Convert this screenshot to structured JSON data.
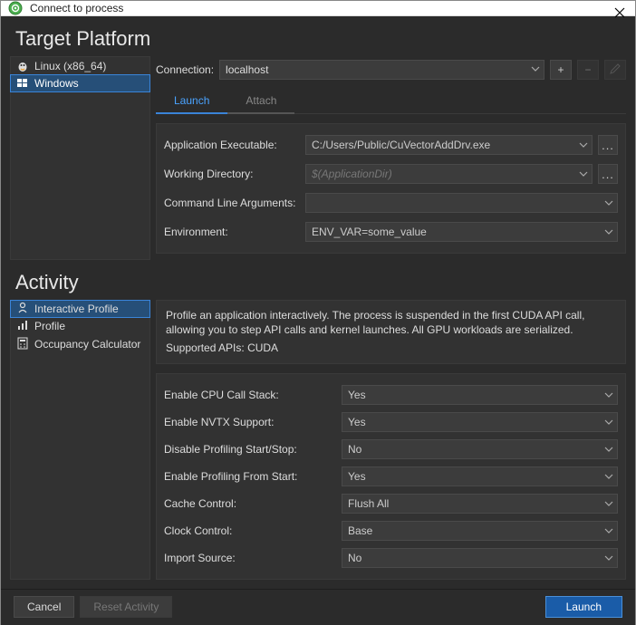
{
  "window": {
    "title": "Connect to process"
  },
  "sections": {
    "target_platform": "Target Platform",
    "activity": "Activity"
  },
  "platforms": [
    {
      "label": "Linux (x86_64)",
      "selected": false
    },
    {
      "label": "Windows",
      "selected": true
    }
  ],
  "connection": {
    "label": "Connection:",
    "value": "localhost",
    "add_label": "+",
    "remove_label": "−",
    "edit_label": "✎"
  },
  "tabs": {
    "launch": "Launch",
    "attach": "Attach"
  },
  "launch_form": {
    "app_exe": {
      "label": "Application Executable:",
      "value": "C:/Users/Public/CuVectorAddDrv.exe"
    },
    "work_dir": {
      "label": "Working Directory:",
      "placeholder": "$(ApplicationDir)"
    },
    "cmd_args": {
      "label": "Command Line Arguments:",
      "value": ""
    },
    "env": {
      "label": "Environment:",
      "value": "ENV_VAR=some_value"
    }
  },
  "activities": [
    {
      "label": "Interactive Profile",
      "selected": true
    },
    {
      "label": "Profile",
      "selected": false
    },
    {
      "label": "Occupancy Calculator",
      "selected": false
    }
  ],
  "activity_desc": {
    "text": "Profile an application interactively. The process is suspended in the first CUDA API call, allowing you to step API calls and kernel launches. All GPU workloads are serialized.",
    "apis_label": "Supported APIs: ",
    "apis_value": "CUDA"
  },
  "options": [
    {
      "label": "Enable CPU Call Stack:",
      "value": "Yes"
    },
    {
      "label": "Enable NVTX Support:",
      "value": "Yes"
    },
    {
      "label": "Disable Profiling Start/Stop:",
      "value": "No"
    },
    {
      "label": "Enable Profiling From Start:",
      "value": "Yes"
    },
    {
      "label": "Cache Control:",
      "value": "Flush All"
    },
    {
      "label": "Clock Control:",
      "value": "Base"
    },
    {
      "label": "Import Source:",
      "value": "No"
    }
  ],
  "buttons": {
    "cancel": "Cancel",
    "reset": "Reset Activity",
    "launch": "Launch"
  }
}
